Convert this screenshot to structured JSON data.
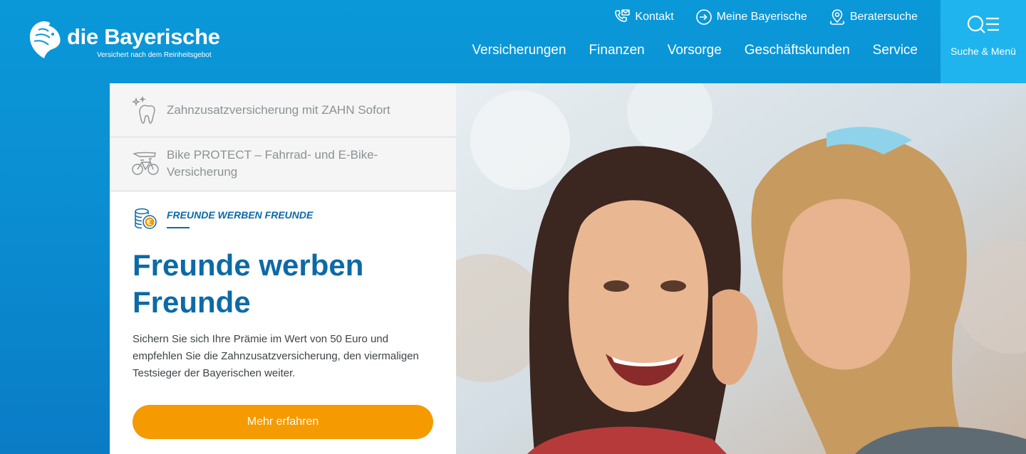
{
  "brand": {
    "name": "die Bayerische",
    "tagline": "Versichert nach dem Reinheitsgebot",
    "accent_color": "#0c6aa6",
    "header_color": "#0a98d8",
    "cta_color": "#f59a00"
  },
  "utility_nav": [
    {
      "label": "Kontakt",
      "icon": "contact-icon"
    },
    {
      "label": "Meine Bayerische",
      "icon": "login-icon"
    },
    {
      "label": "Beratersuche",
      "icon": "location-pin-icon"
    }
  ],
  "main_nav": [
    "Versicherungen",
    "Finanzen",
    "Vorsorge",
    "Geschäftskunden",
    "Service"
  ],
  "menu": {
    "label": "Suche & Menü",
    "icon": "search-menu-icon"
  },
  "teasers": [
    {
      "label": "Zahnzusatzversicherung mit ZAHN Sofort",
      "icon": "tooth-sparkle-icon"
    },
    {
      "label": "Bike PROTECT – Fahrrad- und E-Bike-Versicherung",
      "icon": "bicycle-icon"
    }
  ],
  "feature": {
    "eyebrow": "FREUNDE WERBEN FREUNDE",
    "eyebrow_icon": "coins-euro-icon",
    "headline": "Freunde werben Freunde",
    "body": "Sichern Sie sich Ihre Prämie im Wert von 50 Euro und empfehlen Sie die Zahnzusatzversicherung, den viermaligen Testsieger der Bayerischen weiter.",
    "cta_label": "Mehr erfahren"
  }
}
